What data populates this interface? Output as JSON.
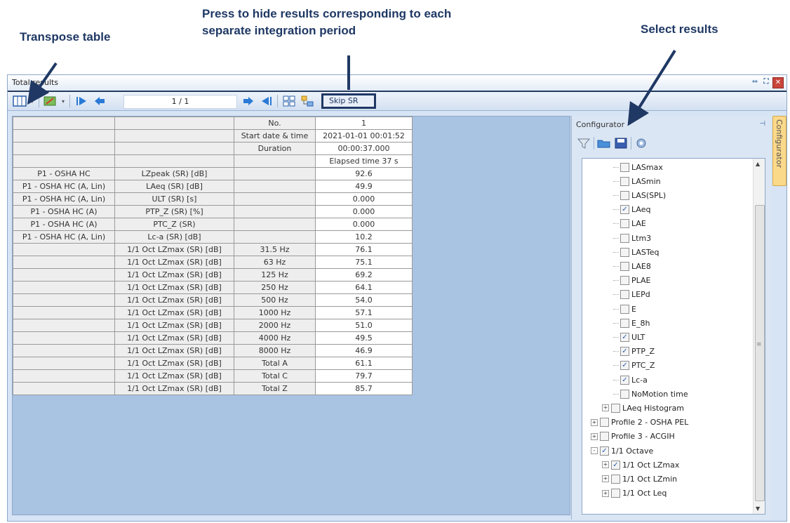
{
  "annotations": {
    "transpose": "Transpose table",
    "skip_line1": "Press to hide results corresponding to each",
    "skip_line2": "separate integration period",
    "select": "Select results"
  },
  "window": {
    "title": "Total results"
  },
  "toolbar": {
    "page_counter": "1 / 1",
    "skip_sr": "Skip SR"
  },
  "table": {
    "rows": [
      [
        "",
        "",
        "No.",
        "1"
      ],
      [
        "",
        "",
        "Start date & time",
        "2021-01-01 00:01:52"
      ],
      [
        "",
        "",
        "Duration",
        "00:00:37.000"
      ],
      [
        "",
        "",
        "",
        "Elapsed time 37 s"
      ],
      [
        "P1 - OSHA HC",
        "LZpeak (SR) [dB]",
        "",
        "92.6"
      ],
      [
        "P1 - OSHA HC (A, Lin)",
        "LAeq (SR) [dB]",
        "",
        "49.9"
      ],
      [
        "P1 - OSHA HC (A, Lin)",
        "ULT (SR) [s]",
        "",
        "0.000"
      ],
      [
        "P1 - OSHA HC (A)",
        "PTP_Z (SR) [%]",
        "",
        "0.000"
      ],
      [
        "P1 - OSHA HC (A)",
        "PTC_Z (SR)",
        "",
        "0.000"
      ],
      [
        "P1 - OSHA HC (A, Lin)",
        "Lc-a (SR) [dB]",
        "",
        "10.2"
      ],
      [
        "",
        "1/1 Oct LZmax (SR) [dB]",
        "31.5 Hz",
        "76.1"
      ],
      [
        "",
        "1/1 Oct LZmax (SR) [dB]",
        "63 Hz",
        "75.1"
      ],
      [
        "",
        "1/1 Oct LZmax (SR) [dB]",
        "125 Hz",
        "69.2"
      ],
      [
        "",
        "1/1 Oct LZmax (SR) [dB]",
        "250 Hz",
        "64.1"
      ],
      [
        "",
        "1/1 Oct LZmax (SR) [dB]",
        "500 Hz",
        "54.0"
      ],
      [
        "",
        "1/1 Oct LZmax (SR) [dB]",
        "1000 Hz",
        "57.1"
      ],
      [
        "",
        "1/1 Oct LZmax (SR) [dB]",
        "2000 Hz",
        "51.0"
      ],
      [
        "",
        "1/1 Oct LZmax (SR) [dB]",
        "4000 Hz",
        "49.5"
      ],
      [
        "",
        "1/1 Oct LZmax (SR) [dB]",
        "8000 Hz",
        "46.9"
      ],
      [
        "",
        "1/1 Oct LZmax (SR) [dB]",
        "Total A",
        "61.1"
      ],
      [
        "",
        "1/1 Oct LZmax (SR) [dB]",
        "Total C",
        "79.7"
      ],
      [
        "",
        "1/1 Oct LZmax (SR) [dB]",
        "Total Z",
        "85.7"
      ]
    ]
  },
  "configurator": {
    "title": "Configurator",
    "side_tab": "Configurator",
    "tree": [
      {
        "label": "LASmax",
        "checked": false,
        "indent": 2,
        "expander": false
      },
      {
        "label": "LASmin",
        "checked": false,
        "indent": 2,
        "expander": false
      },
      {
        "label": "LAS(SPL)",
        "checked": false,
        "indent": 2,
        "expander": false
      },
      {
        "label": "LAeq",
        "checked": true,
        "indent": 2,
        "expander": false
      },
      {
        "label": "LAE",
        "checked": false,
        "indent": 2,
        "expander": false
      },
      {
        "label": "Ltm3",
        "checked": false,
        "indent": 2,
        "expander": false
      },
      {
        "label": "LASTeq",
        "checked": false,
        "indent": 2,
        "expander": false
      },
      {
        "label": "LAE8",
        "checked": false,
        "indent": 2,
        "expander": false
      },
      {
        "label": "PLAE",
        "checked": false,
        "indent": 2,
        "expander": false
      },
      {
        "label": "LEPd",
        "checked": false,
        "indent": 2,
        "expander": false
      },
      {
        "label": "E",
        "checked": false,
        "indent": 2,
        "expander": false
      },
      {
        "label": "E_8h",
        "checked": false,
        "indent": 2,
        "expander": false
      },
      {
        "label": "ULT",
        "checked": true,
        "indent": 2,
        "expander": false
      },
      {
        "label": "PTP_Z",
        "checked": true,
        "indent": 2,
        "expander": false
      },
      {
        "label": "PTC_Z",
        "checked": true,
        "indent": 2,
        "expander": false
      },
      {
        "label": "Lc-a",
        "checked": true,
        "indent": 2,
        "expander": false
      },
      {
        "label": "NoMotion time",
        "checked": false,
        "indent": 2,
        "expander": false
      },
      {
        "label": "LAeq Histogram",
        "checked": false,
        "indent": 1,
        "expander": "+"
      },
      {
        "label": "Profile 2 - OSHA PEL",
        "checked": false,
        "indent": 0,
        "expander": "+"
      },
      {
        "label": "Profile 3 - ACGIH",
        "checked": false,
        "indent": 0,
        "expander": "+"
      },
      {
        "label": "1/1 Octave",
        "checked": true,
        "indent": 0,
        "expander": "-"
      },
      {
        "label": "1/1 Oct LZmax",
        "checked": true,
        "indent": 1,
        "expander": "+"
      },
      {
        "label": "1/1 Oct LZmin",
        "checked": false,
        "indent": 1,
        "expander": "+"
      },
      {
        "label": "1/1 Oct Leq",
        "checked": false,
        "indent": 1,
        "expander": "+"
      }
    ]
  },
  "icons": {
    "transpose": "transpose-table-icon",
    "filter": "filter-icon",
    "open": "folder-open-icon",
    "save": "save-icon",
    "settings": "settings-icon"
  }
}
